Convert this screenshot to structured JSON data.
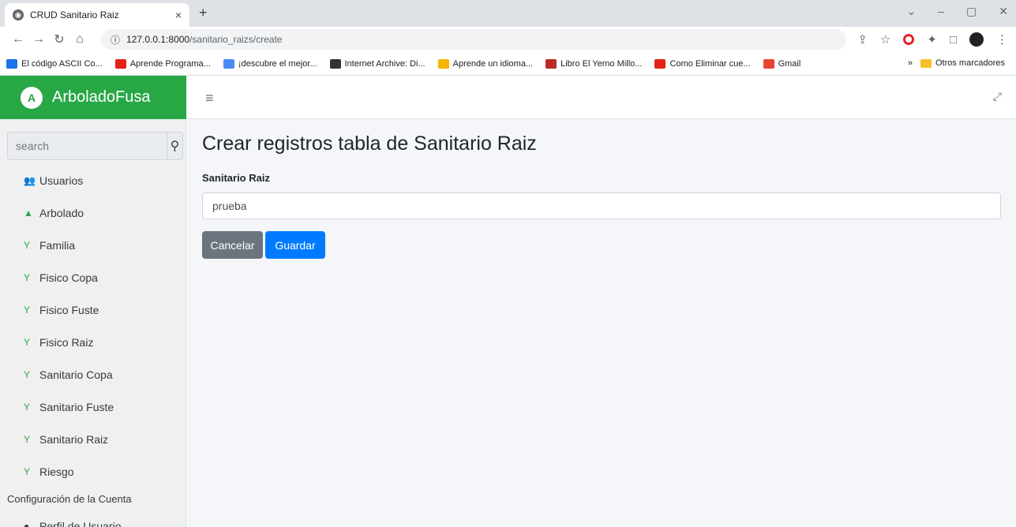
{
  "browser": {
    "tab_title": "CRUD Sanitario Raiz",
    "tab_close": "×",
    "new_tab": "+",
    "url_host": "127.0.0.1:8000",
    "url_path": "/sanitario_raizs/create",
    "bookmarks": [
      {
        "label": "El código ASCII Co...",
        "color": "#1a73e8"
      },
      {
        "label": "Aprende Programa...",
        "color": "#e62117"
      },
      {
        "label": "¡descubre el mejor...",
        "color": "#4c8bf5"
      },
      {
        "label": "Internet Archive: Di...",
        "color": "#333333"
      },
      {
        "label": "Aprende un idioma...",
        "color": "#f4b400"
      },
      {
        "label": "Libro El Yerno Millo...",
        "color": "#b92b27"
      },
      {
        "label": "Como Eliminar cue...",
        "color": "#e62117"
      },
      {
        "label": "Gmail",
        "color": "#ea4335"
      }
    ],
    "more_bookmarks": "»",
    "other_bookmarks": "Otros marcadores"
  },
  "app": {
    "brand": "ArboladoFusa",
    "brand_logo": "A",
    "accent_color": "#28a745"
  },
  "sidebar": {
    "search_placeholder": "search",
    "items": [
      {
        "label": "Usuarios",
        "icon": "users-icon"
      },
      {
        "label": "Arbolado",
        "icon": "tree-icon"
      },
      {
        "label": "Familia",
        "icon": "seedling-icon"
      },
      {
        "label": "Fisico Copa",
        "icon": "seedling-icon"
      },
      {
        "label": "Fisico Fuste",
        "icon": "seedling-icon"
      },
      {
        "label": "Fisico Raiz",
        "icon": "seedling-icon"
      },
      {
        "label": "Sanitario Copa",
        "icon": "seedling-icon"
      },
      {
        "label": "Sanitario Fuste",
        "icon": "seedling-icon"
      },
      {
        "label": "Sanitario Raiz",
        "icon": "seedling-icon"
      },
      {
        "label": "Riesgo",
        "icon": "seedling-icon"
      }
    ],
    "account_header": "Configuración de la Cuenta",
    "profile_item": "Perfil de Usuario"
  },
  "main": {
    "title": "Crear registros tabla de Sanitario Raiz",
    "field_label": "Sanitario Raiz",
    "field_value": "prueba",
    "cancel_label": "Cancelar",
    "save_label": "Guardar"
  }
}
